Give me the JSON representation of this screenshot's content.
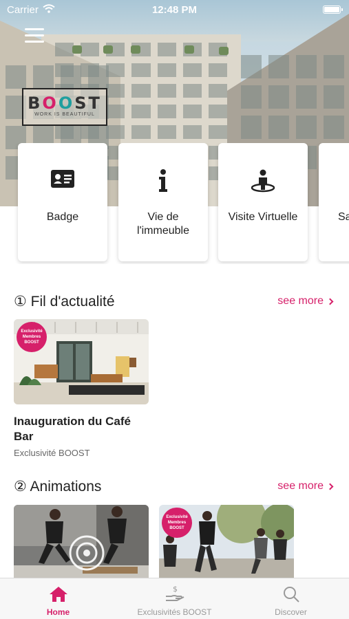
{
  "status_bar": {
    "carrier": "Carrier",
    "time": "12:48 PM"
  },
  "header": {
    "logo": {
      "name": "BOOST",
      "tagline": "WORK IS BEAUTIFUL"
    }
  },
  "shortcuts": [
    {
      "label": "Badge",
      "icon": "id-card-icon"
    },
    {
      "label": "Vie de l'immeuble",
      "icon": "info-icon"
    },
    {
      "label": "Visite Virtuelle",
      "icon": "person-pin-icon"
    },
    {
      "label": "Sa ré",
      "icon": ""
    }
  ],
  "sections": {
    "news": {
      "title": "① Fil d'actualité",
      "see_more": "see more",
      "items": [
        {
          "title": "Inauguration du Café Bar",
          "subtitle": "Exclusivité BOOST",
          "badge": [
            "Exclusivité",
            "Membres",
            "BOOST"
          ]
        }
      ]
    },
    "animations": {
      "title": "② Animations",
      "see_more": "see more",
      "items": [
        {
          "badge": []
        },
        {
          "badge": [
            "Exclusivité",
            "Membres",
            "BOOST"
          ]
        }
      ]
    }
  },
  "tabbar": {
    "tabs": [
      {
        "label": "Home",
        "icon": "home-icon",
        "active": true
      },
      {
        "label": "Exclusivités BOOST",
        "icon": "hand-dollar-icon",
        "active": false
      },
      {
        "label": "Discover",
        "icon": "search-icon",
        "active": false
      }
    ]
  },
  "colors": {
    "accent": "#d6206a",
    "text": "#222222",
    "muted": "#999999"
  }
}
